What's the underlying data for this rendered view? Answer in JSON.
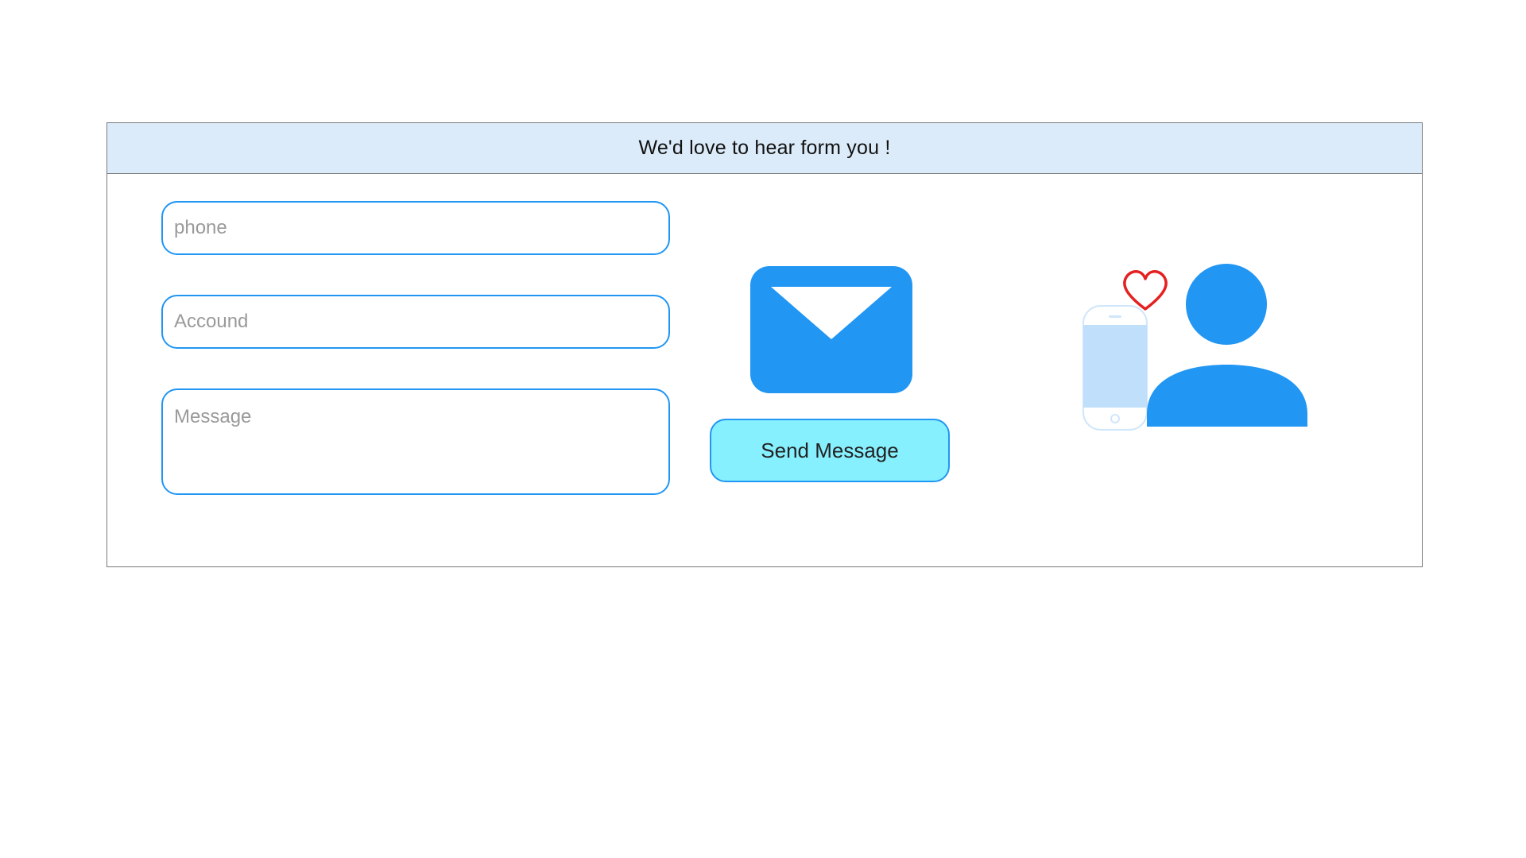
{
  "header": {
    "title": "We'd love to hear form you !"
  },
  "form": {
    "phone_placeholder": "phone",
    "account_placeholder": "Accound",
    "message_placeholder": "Message",
    "send_label": "Send Message"
  },
  "icons": {
    "mail": "mail-icon",
    "contact": "contact-person-icon",
    "phone": "smartphone-icon",
    "heart": "heart-icon"
  },
  "colors": {
    "accent": "#2196f3",
    "header_bg": "#dcebf9",
    "button_bg": "#87f0ff",
    "heart": "#e52020",
    "phone_screen": "#bfdffb"
  }
}
